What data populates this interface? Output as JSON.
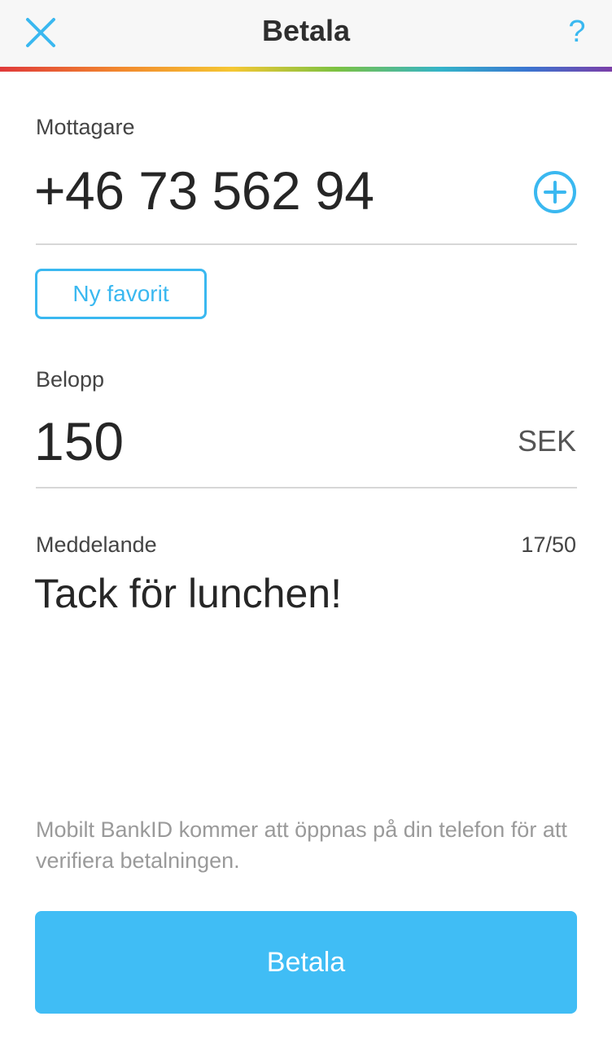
{
  "header": {
    "title": "Betala",
    "help_label": "?",
    "close_icon": "close-icon",
    "accent_color": "#3ab8f0"
  },
  "recipient": {
    "label": "Mottagare",
    "value": "+46 73 562 94",
    "add_icon": "plus-circle-icon",
    "favorite_button": "Ny favorit"
  },
  "amount": {
    "label": "Belopp",
    "value": "150",
    "currency": "SEK"
  },
  "message": {
    "label": "Meddelande",
    "counter": "17/50",
    "value": "Tack för lunchen!"
  },
  "notice": "Mobilt BankID kommer att öppnas på din telefon för att verifiera betalningen.",
  "pay_button": {
    "label": "Betala",
    "color": "#40bdf5"
  }
}
